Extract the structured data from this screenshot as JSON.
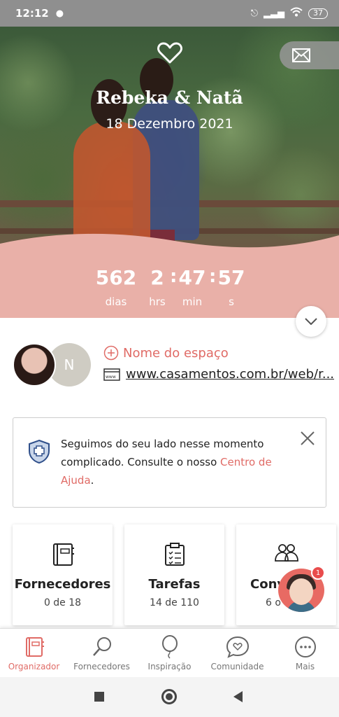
{
  "status_bar": {
    "time": "12:12",
    "battery": "37"
  },
  "hero": {
    "couple_name": "Rebeka & Natã",
    "date": "18 Dezembro 2021"
  },
  "countdown": {
    "days": "562",
    "days_label": "dias",
    "hours": "2",
    "hours_label": "hrs",
    "minutes": "47",
    "minutes_label": "min",
    "seconds": "57",
    "seconds_label": "s",
    "separator": ":"
  },
  "venue": {
    "avatar_initial": "N",
    "add_venue_label": "Nome do espaço",
    "website_url": "www.casamentos.com.br/web/r..."
  },
  "notice": {
    "text": "Seguimos do seu lado nesse momento complicado. Consulte o nosso ",
    "link": "Centro de Ajuda",
    "end": "."
  },
  "cards": [
    {
      "title": "Fornecedores",
      "count": "0 de 18",
      "icon": "notebook-icon"
    },
    {
      "title": "Tarefas",
      "count": "14 de 110",
      "icon": "clipboard-icon"
    },
    {
      "title": "Conv",
      "count": "6 o",
      "icon": "guests-icon"
    }
  ],
  "assistant": {
    "badge": "1"
  },
  "bottom_nav": [
    {
      "label": "Organizador",
      "icon": "organizer-icon",
      "active": true
    },
    {
      "label": "Fornecedores",
      "icon": "magnifier-icon"
    },
    {
      "label": "Inspiração",
      "icon": "balloon-icon"
    },
    {
      "label": "Comunidade",
      "icon": "chat-heart-icon"
    },
    {
      "label": "Mais",
      "icon": "more-icon"
    }
  ],
  "colors": {
    "accent": "#e06b66",
    "countdown_bg": "#e9b0a8",
    "status_bar": "#8f8f8f"
  }
}
